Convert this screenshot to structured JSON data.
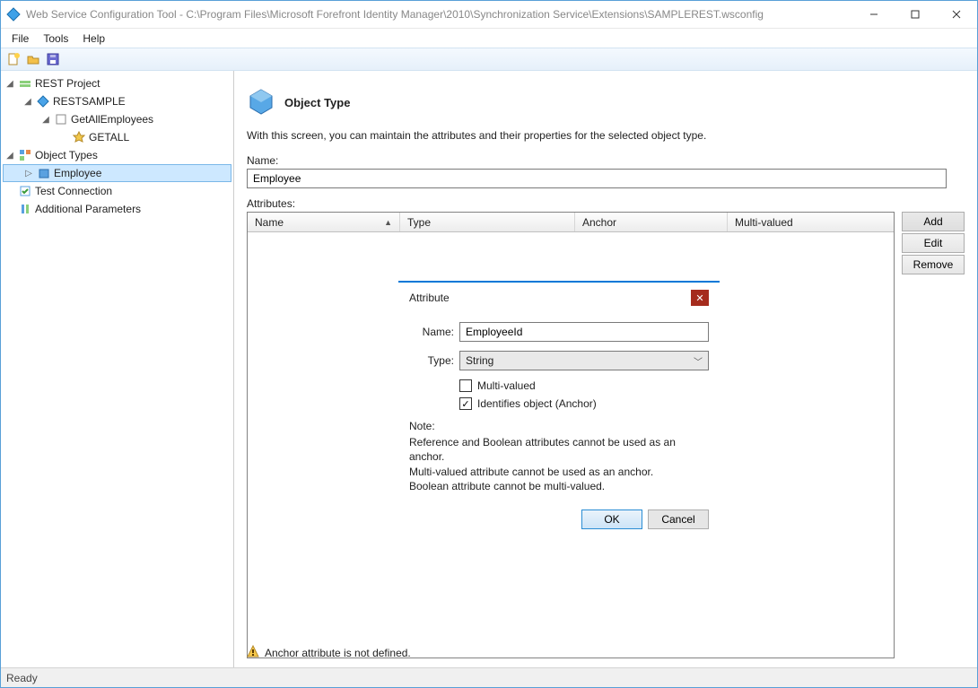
{
  "titlebar": {
    "title": "Web Service Configuration Tool - C:\\Program Files\\Microsoft Forefront Identity Manager\\2010\\Synchronization Service\\Extensions\\SAMPLEREST.wsconfig"
  },
  "menu": {
    "file": "File",
    "tools": "Tools",
    "help": "Help"
  },
  "tree": {
    "rest_project": "REST Project",
    "restsample": "RESTSAMPLE",
    "getallemployees": "GetAllEmployees",
    "getall": "GETALL",
    "object_types": "Object Types",
    "employee": "Employee",
    "test_connection": "Test Connection",
    "additional_parameters": "Additional Parameters"
  },
  "content": {
    "section_title": "Object Type",
    "section_desc": "With this screen, you can maintain the attributes and their properties for the selected object type.",
    "name_label": "Name:",
    "name_value": "Employee",
    "attributes_label": "Attributes:",
    "cols": {
      "name": "Name",
      "type": "Type",
      "anchor": "Anchor",
      "multiv": "Multi-valued"
    },
    "buttons": {
      "add": "Add",
      "edit": "Edit",
      "remove": "Remove"
    },
    "warning": "Anchor attribute is not defined."
  },
  "modal": {
    "title": "Attribute",
    "name_label": "Name:",
    "name_value": "EmployeeId",
    "type_label": "Type:",
    "type_value": "String",
    "multi_valued": "Multi-valued",
    "anchor": "Identifies object (Anchor)",
    "note_title": "Note:",
    "note_line1": "Reference and Boolean attributes cannot be used as an anchor.",
    "note_line2": "Multi-valued attribute cannot be used as an anchor.",
    "note_line3": "Boolean attribute cannot be multi-valued.",
    "ok": "OK",
    "cancel": "Cancel"
  },
  "status": {
    "text": "Ready"
  }
}
